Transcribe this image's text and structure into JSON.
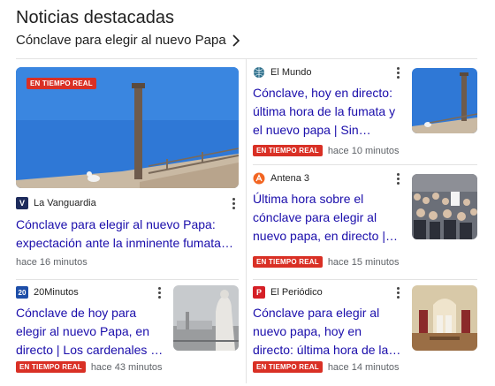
{
  "section": {
    "title": "Noticias destacadas",
    "subtitle": "Cónclave para elegir al nuevo Papa"
  },
  "colors": {
    "link": "#1a0dab",
    "badge": "#d93025",
    "meta": "#5f6368"
  },
  "live_label": "EN TIEMPO REAL",
  "featured": {
    "source": "La Vanguardia",
    "logo_text": "V",
    "headline": "Cónclave para elegir al nuevo Papa: expectación ante la inminente fumata, en...",
    "time": "hace 16 minutos"
  },
  "card_elmundo": {
    "source": "El Mundo",
    "headline": "Cónclave, hoy en directo: última hora de la fumata y el nuevo papa | Sin fumata...",
    "time": "hace 10 minutos"
  },
  "card_antena3": {
    "source": "Antena 3",
    "headline": "Última hora sobre el cónclave para elegir al nuevo papa, en directo | Segunda jornada de...",
    "time": "hace 15 minutos"
  },
  "card_20minutos": {
    "source": "20Minutos",
    "logo_text": "20",
    "headline": "Cónclave de hoy para elegir al nuevo Papa, en directo | Los cardenales se encamin...",
    "time": "hace 43 minutos"
  },
  "card_elperiodico": {
    "source": "El Periódico",
    "logo_text": "P",
    "headline": "Cónclave para elegir al nuevo papa, hoy en directo: última hora de la votación y hora ...",
    "time": "hace 14 minutos"
  }
}
